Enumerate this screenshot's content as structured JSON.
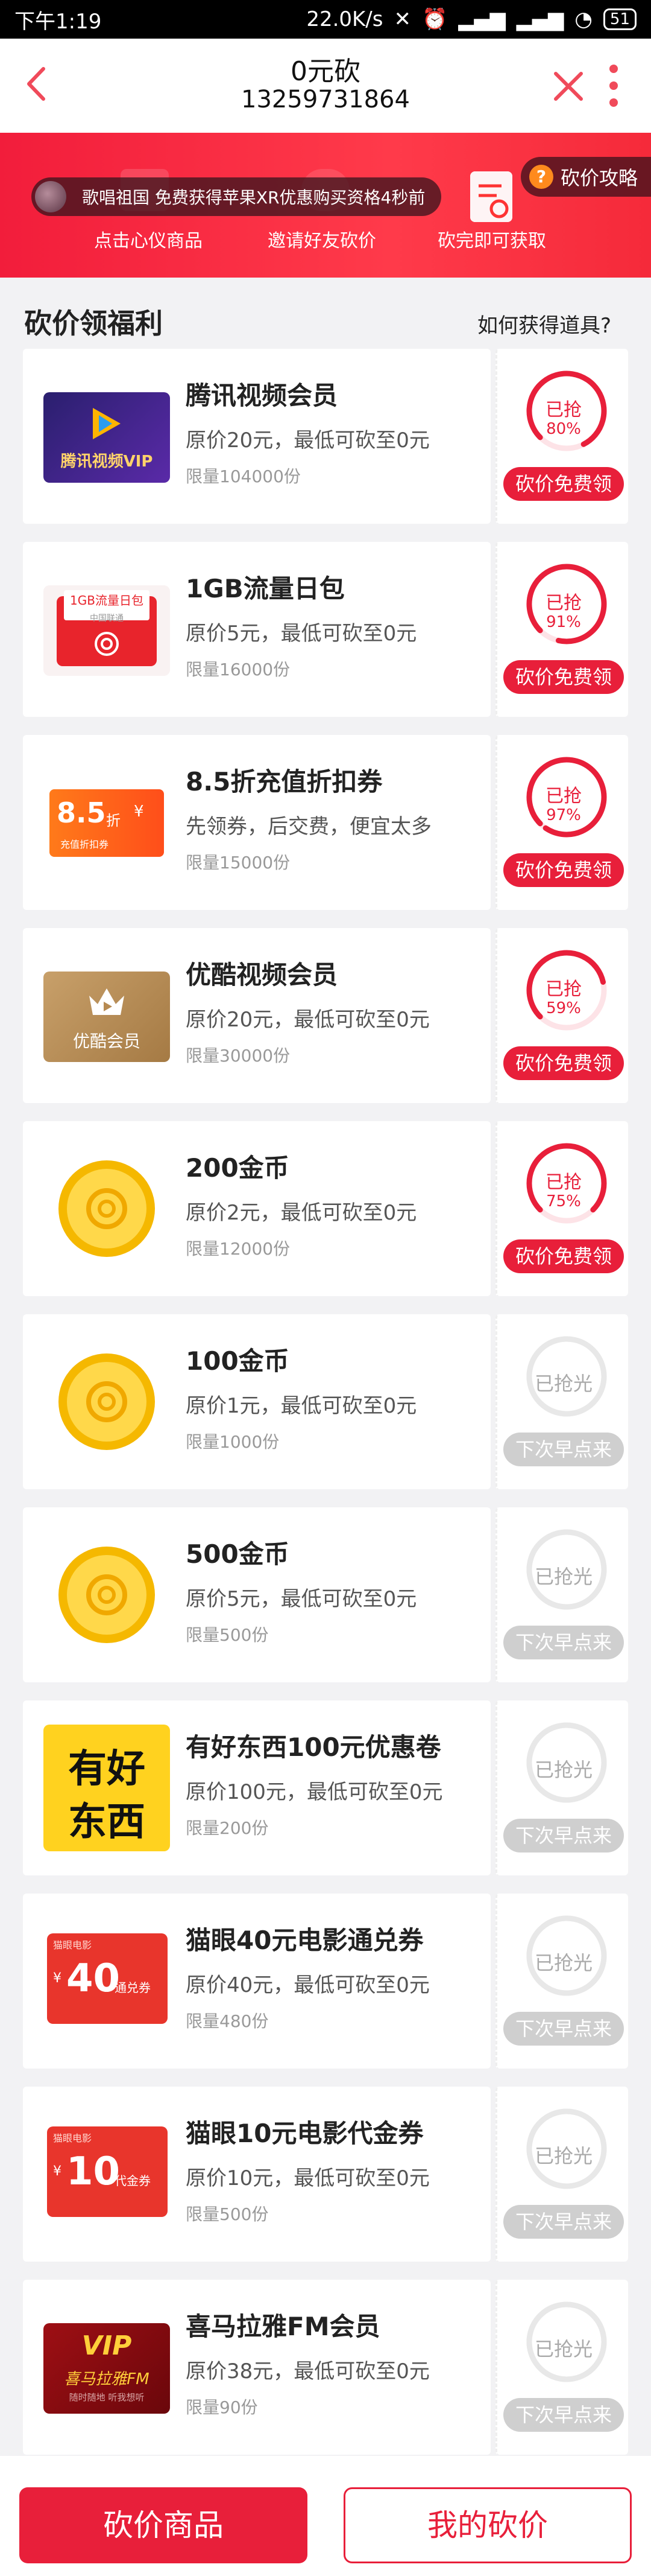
{
  "status_bar": {
    "time": "下午1:19",
    "speed": "22.0K/s",
    "battery": "51"
  },
  "header": {
    "title": "0元砍",
    "subtitle": "13259731864"
  },
  "banner": {
    "marquee": "歌唱祖国 免费获得苹果XR优惠购买资格4秒前",
    "strategy": "砍价攻略",
    "steps": [
      "点击心仪商品",
      "邀请好友砍价",
      "砍完即可获取"
    ]
  },
  "section": {
    "title": "砍价领福利",
    "link": "如何获得道具?"
  },
  "products": [
    {
      "name": "腾讯视频会员",
      "desc": "原价20元，最低可砍至0元",
      "limit": "限量104000份",
      "status": "已抢",
      "pct": "80%",
      "progress": 0.8,
      "button": "砍价免费领",
      "available": true
    },
    {
      "name": "1GB流量日包",
      "desc": "原价5元，最低可砍至0元",
      "limit": "限量16000份",
      "status": "已抢",
      "pct": "91%",
      "progress": 0.91,
      "button": "砍价免费领",
      "available": true
    },
    {
      "name": "8.5折充值折扣券",
      "desc": "先领券，后交费，便宜太多",
      "limit": "限量15000份",
      "status": "已抢",
      "pct": "97%",
      "progress": 0.97,
      "button": "砍价免费领",
      "available": true
    },
    {
      "name": "优酷视频会员",
      "desc": "原价20元，最低可砍至0元",
      "limit": "限量30000份",
      "status": "已抢",
      "pct": "59%",
      "progress": 0.59,
      "button": "砍价免费领",
      "available": true
    },
    {
      "name": "200金币",
      "desc": "原价2元，最低可砍至0元",
      "limit": "限量12000份",
      "status": "已抢",
      "pct": "75%",
      "progress": 0.75,
      "button": "砍价免费领",
      "available": true
    },
    {
      "name": "100金币",
      "desc": "原价1元，最低可砍至0元",
      "limit": "限量1000份",
      "status": "已抢光",
      "pct": "",
      "progress": 1.0,
      "button": "下次早点来",
      "available": false
    },
    {
      "name": "500金币",
      "desc": "原价5元，最低可砍至0元",
      "limit": "限量500份",
      "status": "已抢光",
      "pct": "",
      "progress": 1.0,
      "button": "下次早点来",
      "available": false
    },
    {
      "name": "有好东西100元优惠卷",
      "desc": "原价100元，最低可砍至0元",
      "limit": "限量200份",
      "status": "已抢光",
      "pct": "",
      "progress": 1.0,
      "button": "下次早点来",
      "available": false
    },
    {
      "name": "猫眼40元电影通兑券",
      "desc": "原价40元，最低可砍至0元",
      "limit": "限量480份",
      "status": "已抢光",
      "pct": "",
      "progress": 1.0,
      "button": "下次早点来",
      "available": false
    },
    {
      "name": "猫眼10元电影代金券",
      "desc": "原价10元，最低可砍至0元",
      "limit": "限量500份",
      "status": "已抢光",
      "pct": "",
      "progress": 1.0,
      "button": "下次早点来",
      "available": false
    },
    {
      "name": "喜马拉雅FM会员",
      "desc": "原价38元，最低可砍至0元",
      "limit": "限量90份",
      "status": "已抢光",
      "pct": "",
      "progress": 1.0,
      "button": "下次早点来",
      "available": false
    }
  ],
  "thumb_text": {
    "tencent": "腾讯视频VIP",
    "flow_title": "1GB流量日包",
    "flow_sub": "中国联通",
    "coupon_big": "8.5",
    "coupon_unit": "折",
    "coupon_yen": "¥",
    "coupon_sub": "充值折扣券",
    "youku": "优酷会员",
    "hao1": "有好",
    "hao2": "东西",
    "maoyan40_head": "猫眼电影",
    "maoyan40_yen": "¥",
    "maoyan40": "40",
    "maoyan40_sub": "通兑券",
    "maoyan10_head": "猫眼电影",
    "maoyan10_yen": "¥",
    "maoyan10": "10",
    "maoyan10_sub": "代金券",
    "vip": "VIP",
    "xmly": "喜马拉雅FM",
    "xmly_sub": "随时随地 听我想听"
  },
  "bottom": {
    "left": "砍价商品",
    "right": "我的砍价"
  },
  "colors": {
    "accent": "#e81f3a",
    "disabled": "#cfcfcf"
  }
}
